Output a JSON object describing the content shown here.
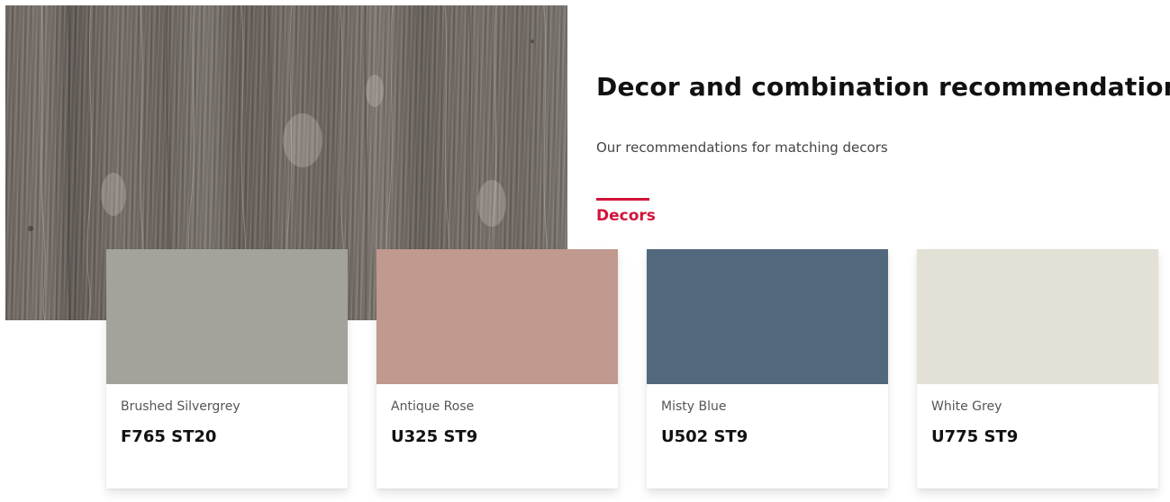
{
  "heading": {
    "title": "Decor and combination recommendations",
    "subtitle": "Our recommendations for matching decors"
  },
  "tabs": {
    "active_label": "Decors",
    "accent_color": "#d2143a"
  },
  "decors": [
    {
      "name": "Brushed Silvergrey",
      "code": "F765 ST20",
      "color": "#a3a39c"
    },
    {
      "name": "Antique Rose",
      "code": "U325 ST9",
      "color": "#c0998f"
    },
    {
      "name": "Misty Blue",
      "code": "U502 ST9",
      "color": "#52687d"
    },
    {
      "name": "White Grey",
      "code": "U775 ST9",
      "color": "#e3e0d6"
    }
  ]
}
